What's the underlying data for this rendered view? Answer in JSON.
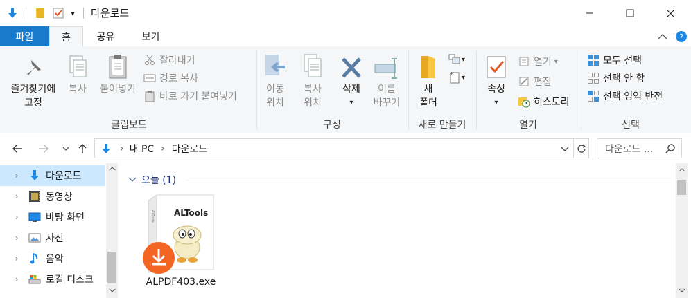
{
  "window": {
    "title": "다운로드",
    "qa_dropdown": "▾"
  },
  "tabs": [
    {
      "label": "파일"
    },
    {
      "label": "홈"
    },
    {
      "label": "공유"
    },
    {
      "label": "보기"
    }
  ],
  "ribbon": {
    "clipboard": {
      "pin_line1": "즐겨찾기에",
      "pin_line2": "고정",
      "copy": "복사",
      "paste": "붙여넣기",
      "cut": "잘라내기",
      "copy_path": "경로 복사",
      "paste_shortcut": "바로 가기 붙여넣기",
      "label": "클립보드"
    },
    "organize": {
      "move_line1": "이동",
      "move_line2": "위치",
      "copyto_line1": "복사",
      "copyto_line2": "위치",
      "delete": "삭제",
      "rename_line1": "이름",
      "rename_line2": "바꾸기",
      "label": "구성"
    },
    "new": {
      "folder_line1": "새",
      "folder_line2": "폴더",
      "label": "새로 만들기"
    },
    "open": {
      "properties": "속성",
      "open": "열기",
      "edit": "편집",
      "history": "히스토리",
      "label": "열기"
    },
    "select": {
      "select_all": "모두 선택",
      "select_none": "선택 안 함",
      "invert": "선택 영역 반전",
      "label": "선택"
    }
  },
  "address": {
    "crumb1": "내 PC",
    "crumb2": "다운로드",
    "separator": "›",
    "search_placeholder": "다운로드 ..."
  },
  "nav_pane": [
    {
      "label": "다운로드",
      "icon": "download-icon",
      "selected": true
    },
    {
      "label": "동영상",
      "icon": "video-icon"
    },
    {
      "label": "바탕 화면",
      "icon": "desktop-icon"
    },
    {
      "label": "사진",
      "icon": "picture-icon"
    },
    {
      "label": "음악",
      "icon": "music-icon"
    },
    {
      "label": "로컬 디스크",
      "icon": "drive-icon"
    }
  ],
  "content": {
    "group_header": "오늘 (1)",
    "files": [
      {
        "name": "ALPDF403.exe",
        "box_text": "ALTools",
        "box_side_text": "ALTools"
      }
    ]
  },
  "colors": {
    "accent": "#1979ca",
    "selection": "#cce8ff",
    "group_header": "#1e3287",
    "badge_orange": "#f26522"
  }
}
